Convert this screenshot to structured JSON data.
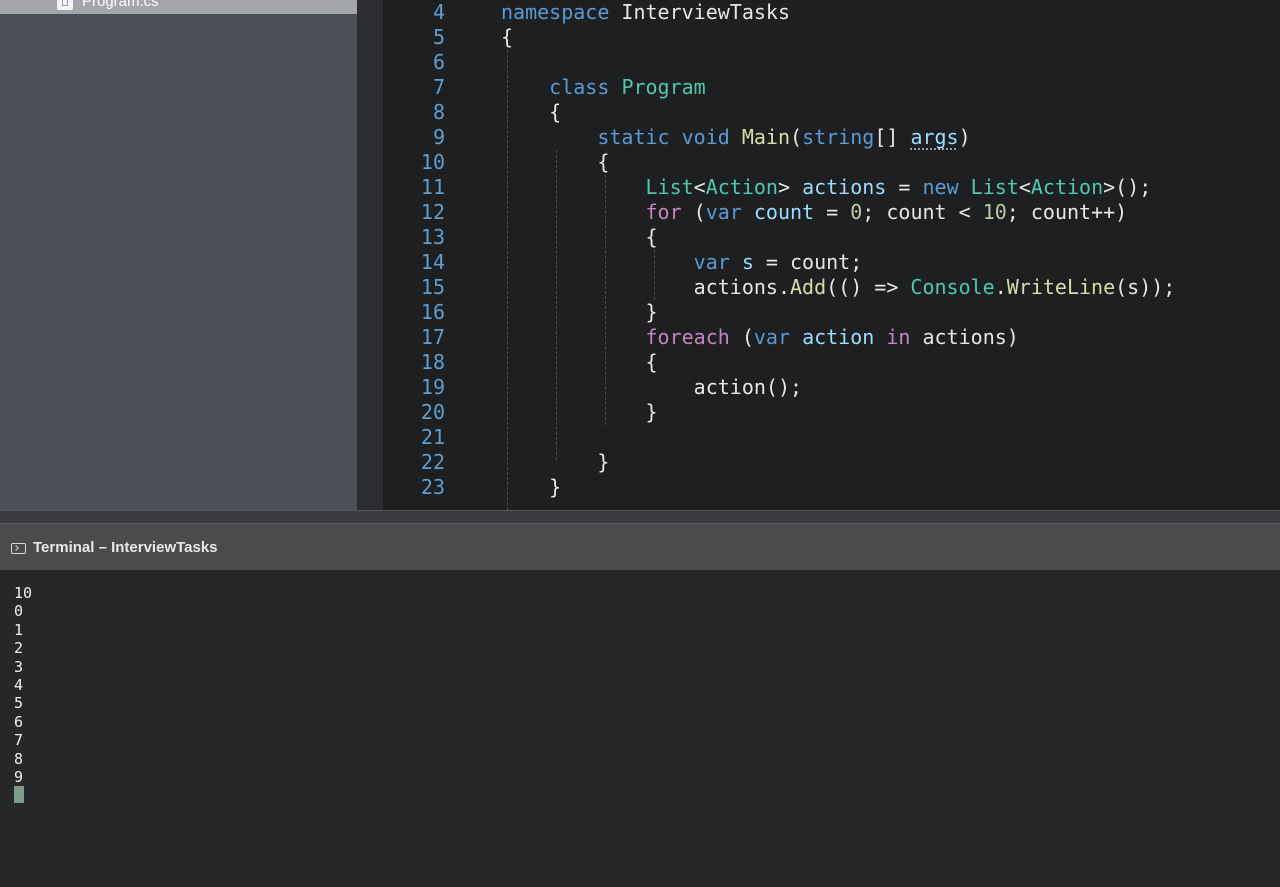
{
  "sidebar": {
    "file_name": "Program.cs",
    "file_icon": "csharp-file-icon"
  },
  "editor": {
    "line_numbers": [
      "4",
      "5",
      "6",
      "7",
      "8",
      "9",
      "10",
      "11",
      "12",
      "13",
      "14",
      "15",
      "16",
      "17",
      "18",
      "19",
      "20",
      "21",
      "22",
      "23"
    ]
  },
  "terminal": {
    "title": "Terminal – InterviewTasks",
    "icon": "terminal-icon",
    "output": [
      "10",
      "0",
      "1",
      "2",
      "3",
      "4",
      "5",
      "6",
      "7",
      "8",
      "9"
    ]
  },
  "colors": {
    "keyword": "#5b9bd5",
    "control_keyword": "#c586c0",
    "type": "#4ec9b0",
    "method": "#dcdcaa",
    "variable": "#9cdcfe",
    "number": "#b5cea8",
    "line_number": "#5d9fd0"
  }
}
